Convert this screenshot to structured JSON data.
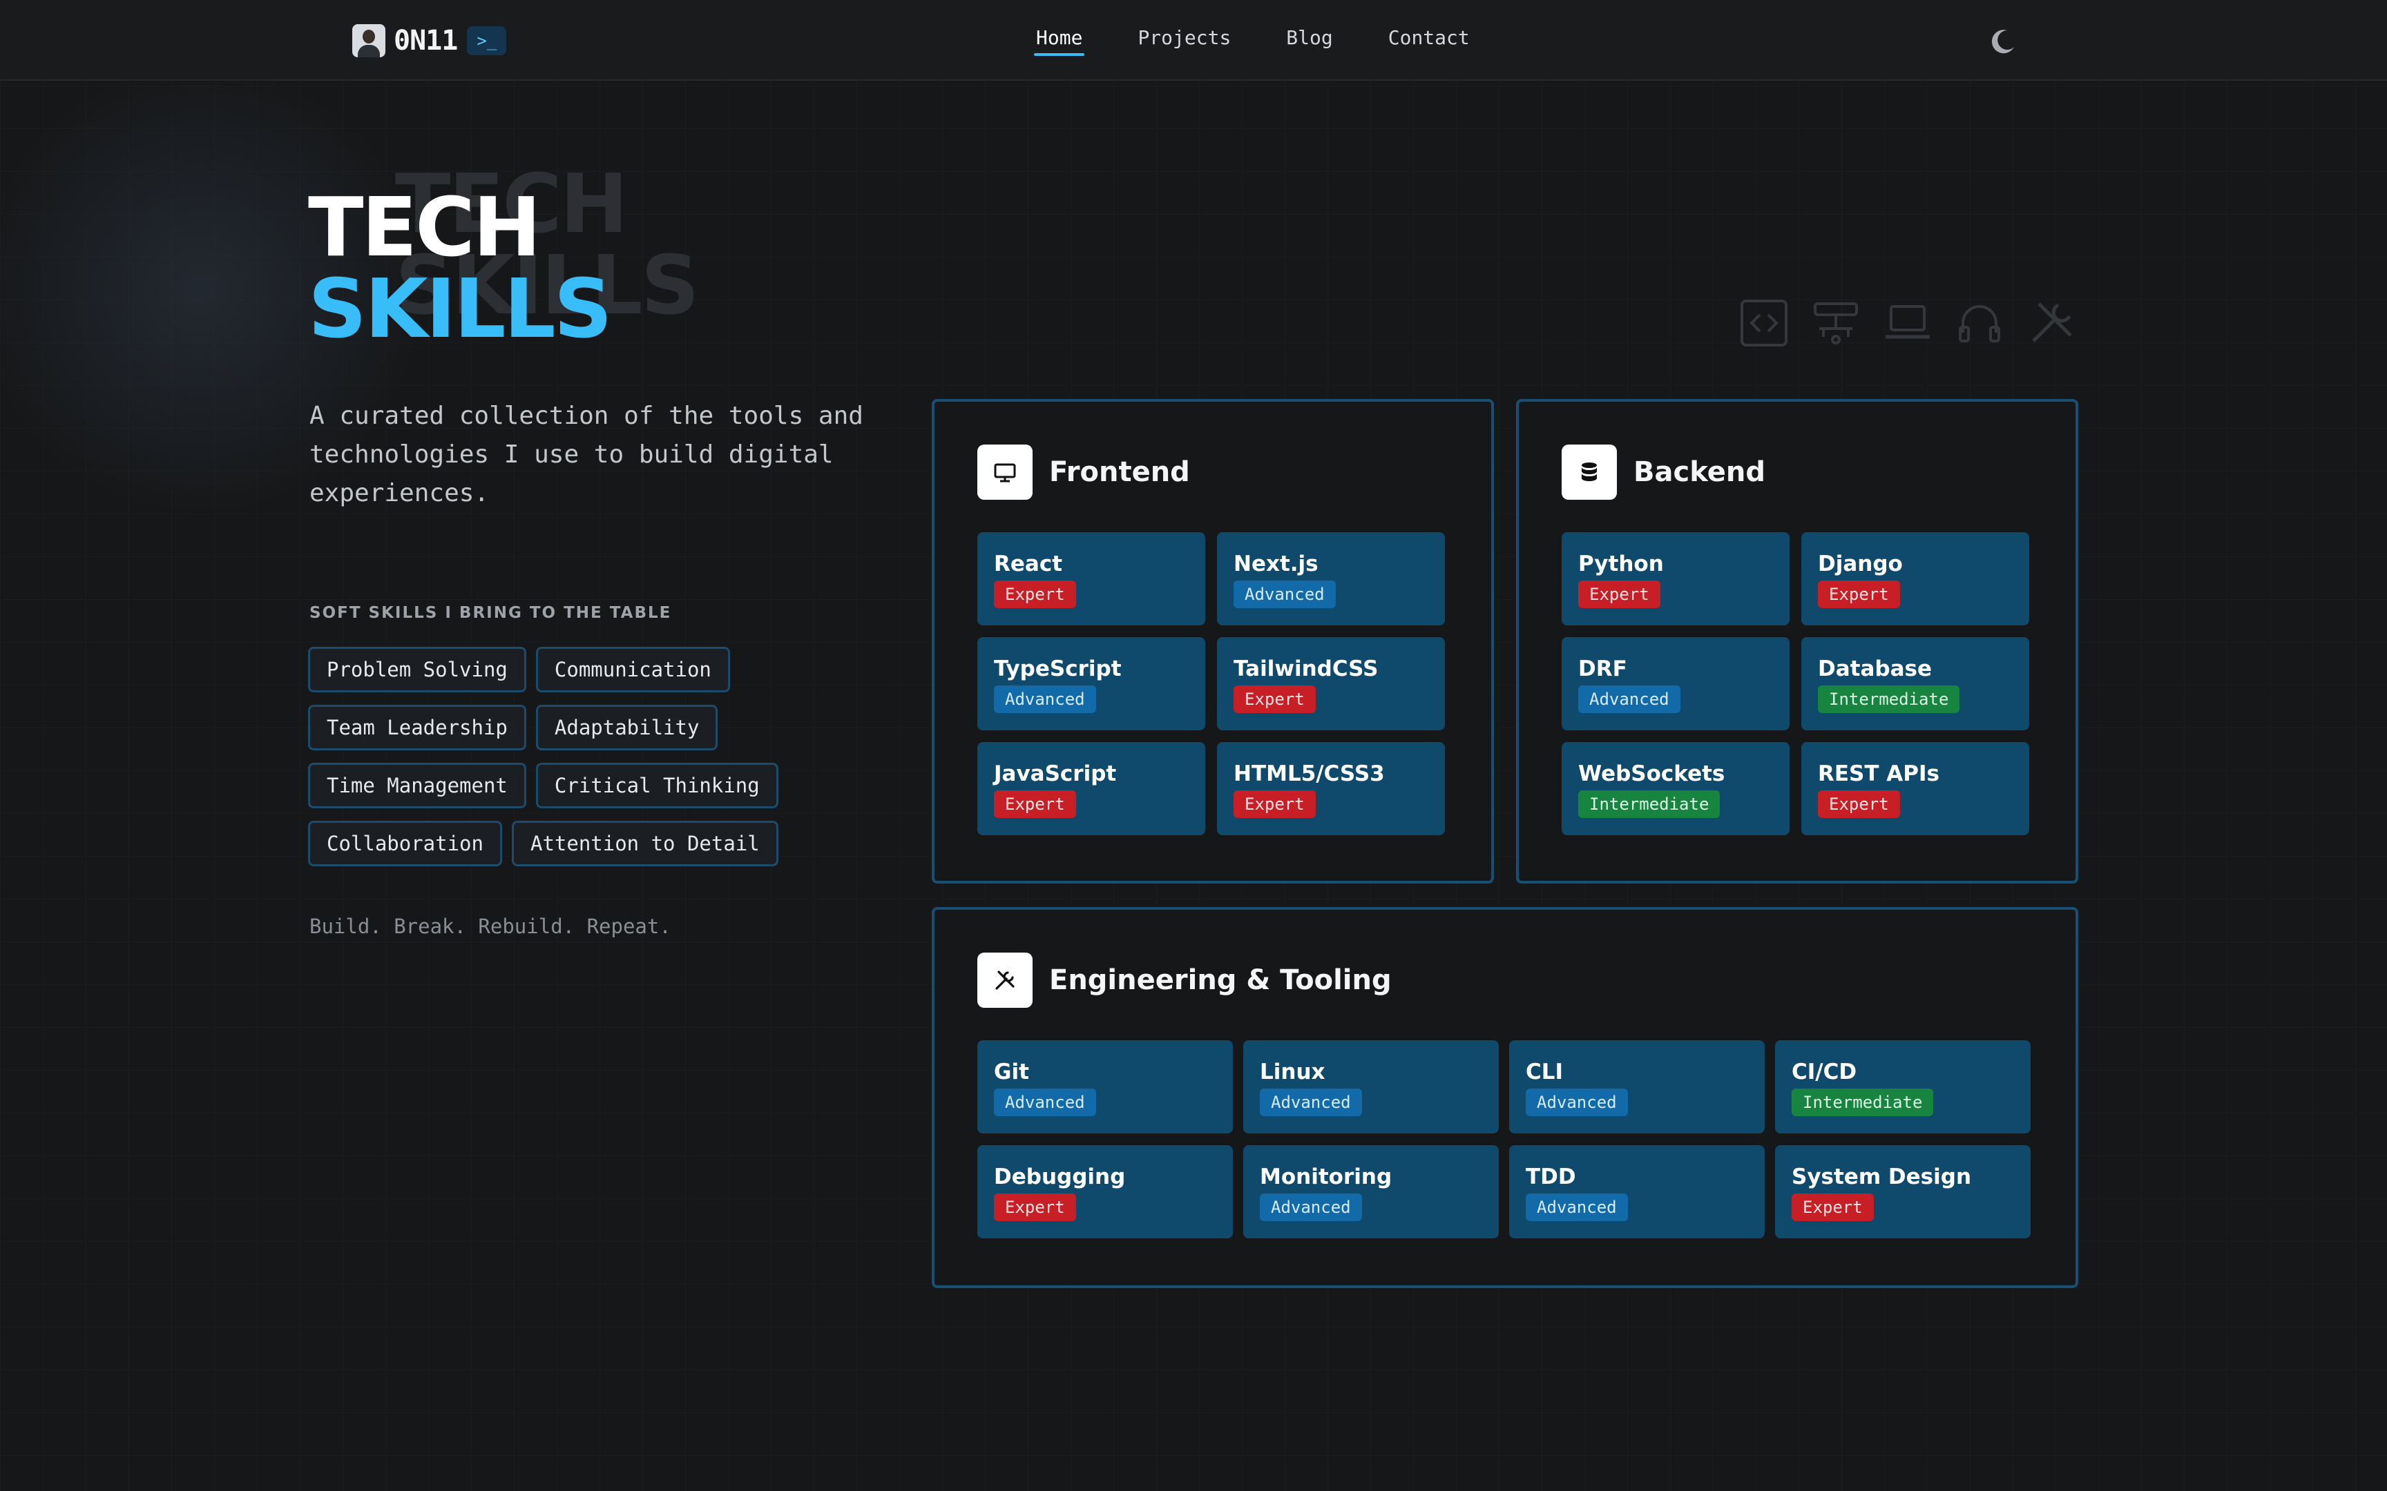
{
  "colors": {
    "accent": "#38bdf8",
    "card_border": "#184f75",
    "tile_bg": "#0f4a6d",
    "expert": "#c81e26",
    "advanced": "#136aa8",
    "intermediate": "#17843f"
  },
  "brand": {
    "name": "0N11",
    "badge": ">_",
    "avatar_icon": "avatar-photo"
  },
  "nav": {
    "links": [
      "Home",
      "Projects",
      "Blog",
      "Contact"
    ],
    "active": "Home",
    "theme_icon": "moon-icon"
  },
  "hero": {
    "title_line1": "TECH",
    "title_line2": "SKILLS",
    "ghost_line1": "TECH",
    "ghost_line2": "SKILLS",
    "description": "A curated collection of the tools and technologies I use to build digital experiences.",
    "decor_icons": [
      "code-icon",
      "network-icon",
      "laptop-icon",
      "headphones-icon",
      "tools-icon"
    ]
  },
  "soft_skills": {
    "label": "SOFT SKILLS I BRING TO THE TABLE",
    "items": [
      "Problem Solving",
      "Communication",
      "Team Leadership",
      "Adaptability",
      "Time Management",
      "Critical Thinking",
      "Collaboration",
      "Attention to Detail"
    ]
  },
  "tagline": "Build. Break. Rebuild. Repeat.",
  "frontend": {
    "title": "Frontend",
    "icon": "monitor-icon",
    "skills": [
      {
        "name": "React",
        "level": "Expert"
      },
      {
        "name": "Next.js",
        "level": "Advanced"
      },
      {
        "name": "TypeScript",
        "level": "Advanced"
      },
      {
        "name": "TailwindCSS",
        "level": "Expert"
      },
      {
        "name": "JavaScript",
        "level": "Expert"
      },
      {
        "name": "HTML5/CSS3",
        "level": "Expert"
      }
    ]
  },
  "backend": {
    "title": "Backend",
    "icon": "database-icon",
    "skills": [
      {
        "name": "Python",
        "level": "Expert"
      },
      {
        "name": "Django",
        "level": "Expert"
      },
      {
        "name": "DRF",
        "level": "Advanced"
      },
      {
        "name": "Database",
        "level": "Intermediate"
      },
      {
        "name": "WebSockets",
        "level": "Intermediate"
      },
      {
        "name": "REST APIs",
        "level": "Expert"
      }
    ]
  },
  "tooling": {
    "title": "Engineering & Tooling",
    "icon": "tools-icon",
    "skills": [
      {
        "name": "Git",
        "level": "Advanced"
      },
      {
        "name": "Linux",
        "level": "Advanced"
      },
      {
        "name": "CLI",
        "level": "Advanced"
      },
      {
        "name": "CI/CD",
        "level": "Intermediate"
      },
      {
        "name": "Debugging",
        "level": "Expert"
      },
      {
        "name": "Monitoring",
        "level": "Advanced"
      },
      {
        "name": "TDD",
        "level": "Advanced"
      },
      {
        "name": "System Design",
        "level": "Expert"
      }
    ]
  }
}
